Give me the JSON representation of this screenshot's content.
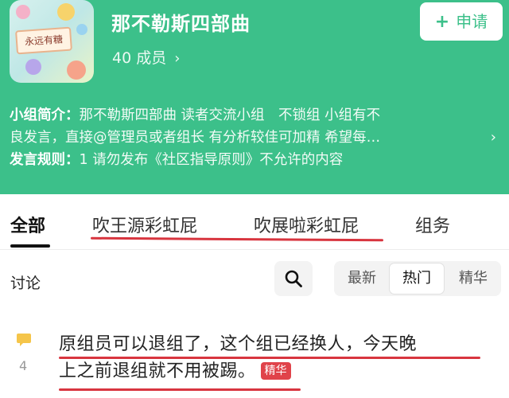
{
  "group": {
    "name": "那不勒斯四部曲",
    "members": "40 成员",
    "apply_label": "申请",
    "avatar_text": "永远有糖",
    "intro_label": "小组简介：",
    "intro_line1": "那不勒斯四部曲 读者交流小组　不锁组 小组有不",
    "intro_line2": "良发言，直接@管理员或者组长 有分析较佳可加精 希望每…",
    "rules_label": "发言规则：",
    "rules_text": "1 请勿发布《社区指导原则》不允许的内容"
  },
  "tabs": [
    "全部",
    "吹王源彩虹屁",
    "吹展啦彩虹屁",
    "组务"
  ],
  "discussion": {
    "label": "讨论",
    "sort_options": [
      "最新",
      "热门",
      "精华"
    ],
    "selected": "热门"
  },
  "post": {
    "comment_count": "4",
    "line1": "原组员可以退组了，这个组已经换人，今天晚",
    "line2": "上之前退组就不用被踢。",
    "badge": "精华"
  },
  "colors": {
    "header_green": "#3cc08a",
    "annotation_red": "#d8353f",
    "badge_red": "#e0434a",
    "comment_icon": "#f5c54a"
  },
  "icons": [
    "chevron-right-icon",
    "plus-icon",
    "search-icon",
    "comment-icon"
  ]
}
